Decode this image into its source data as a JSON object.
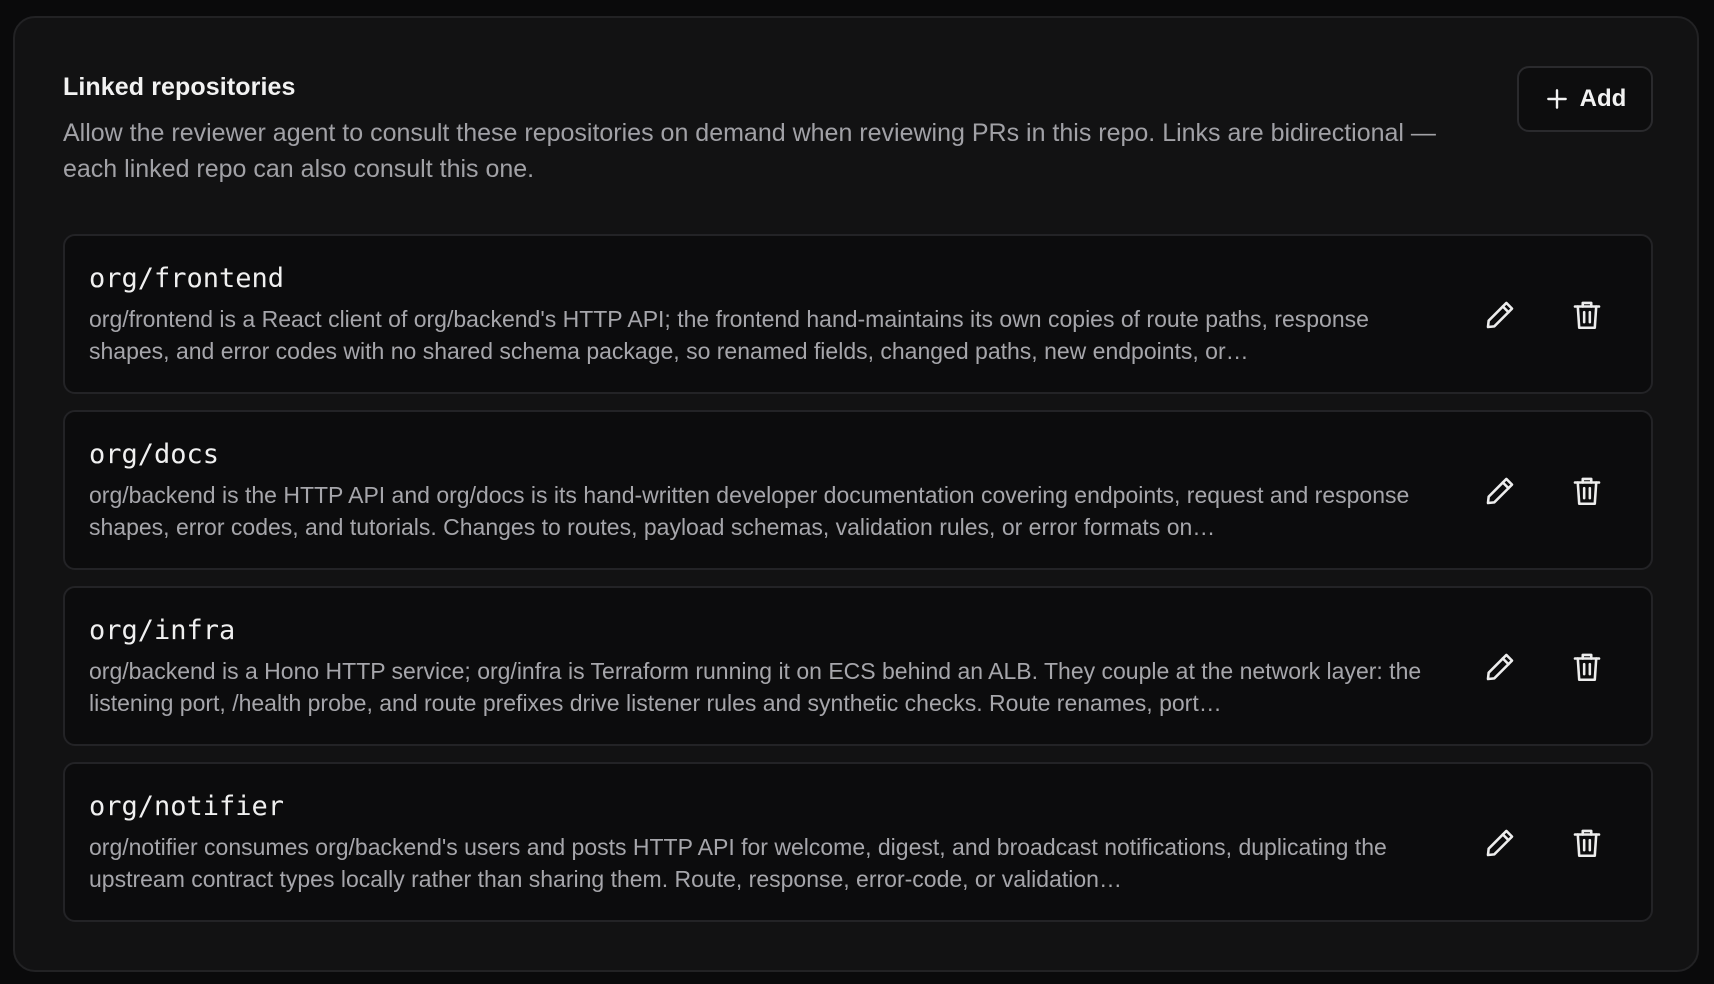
{
  "header": {
    "title": "Linked repositories",
    "description": "Allow the reviewer agent to consult these repositories on demand when reviewing PRs in this repo. Links are bidirectional — each linked repo can also consult this one.",
    "add_label": "Add"
  },
  "repos": [
    {
      "name": "org/frontend",
      "description": "org/frontend is a React client of org/backend's HTTP API; the frontend hand-maintains its own copies of route paths, response shapes, and error codes with no shared schema package, so renamed fields, changed paths, new endpoints, or…"
    },
    {
      "name": "org/docs",
      "description": "org/backend is the HTTP API and org/docs is its hand-written developer documentation covering endpoints, request and response shapes, error codes, and tutorials. Changes to routes, payload schemas, validation rules, or error formats on…"
    },
    {
      "name": "org/infra",
      "description": "org/backend is a Hono HTTP service; org/infra is Terraform running it on ECS behind an ALB. They couple at the network layer: the listening port, /health probe, and route prefixes drive listener rules and synthetic checks. Route renames, port…"
    },
    {
      "name": "org/notifier",
      "description": "org/notifier consumes org/backend's users and posts HTTP API for welcome, digest, and broadcast notifications, duplicating the upstream contract types locally rather than sharing them. Route, response, error-code, or validation…"
    }
  ],
  "icons": {
    "add": "plus-icon",
    "edit": "pencil-icon",
    "delete": "trash-icon"
  },
  "colors": {
    "background": "#0a0a0b",
    "panel": "#121213",
    "card": "#0c0c0d",
    "text_primary": "#f2f2f2",
    "text_secondary": "#a1a1a6"
  }
}
